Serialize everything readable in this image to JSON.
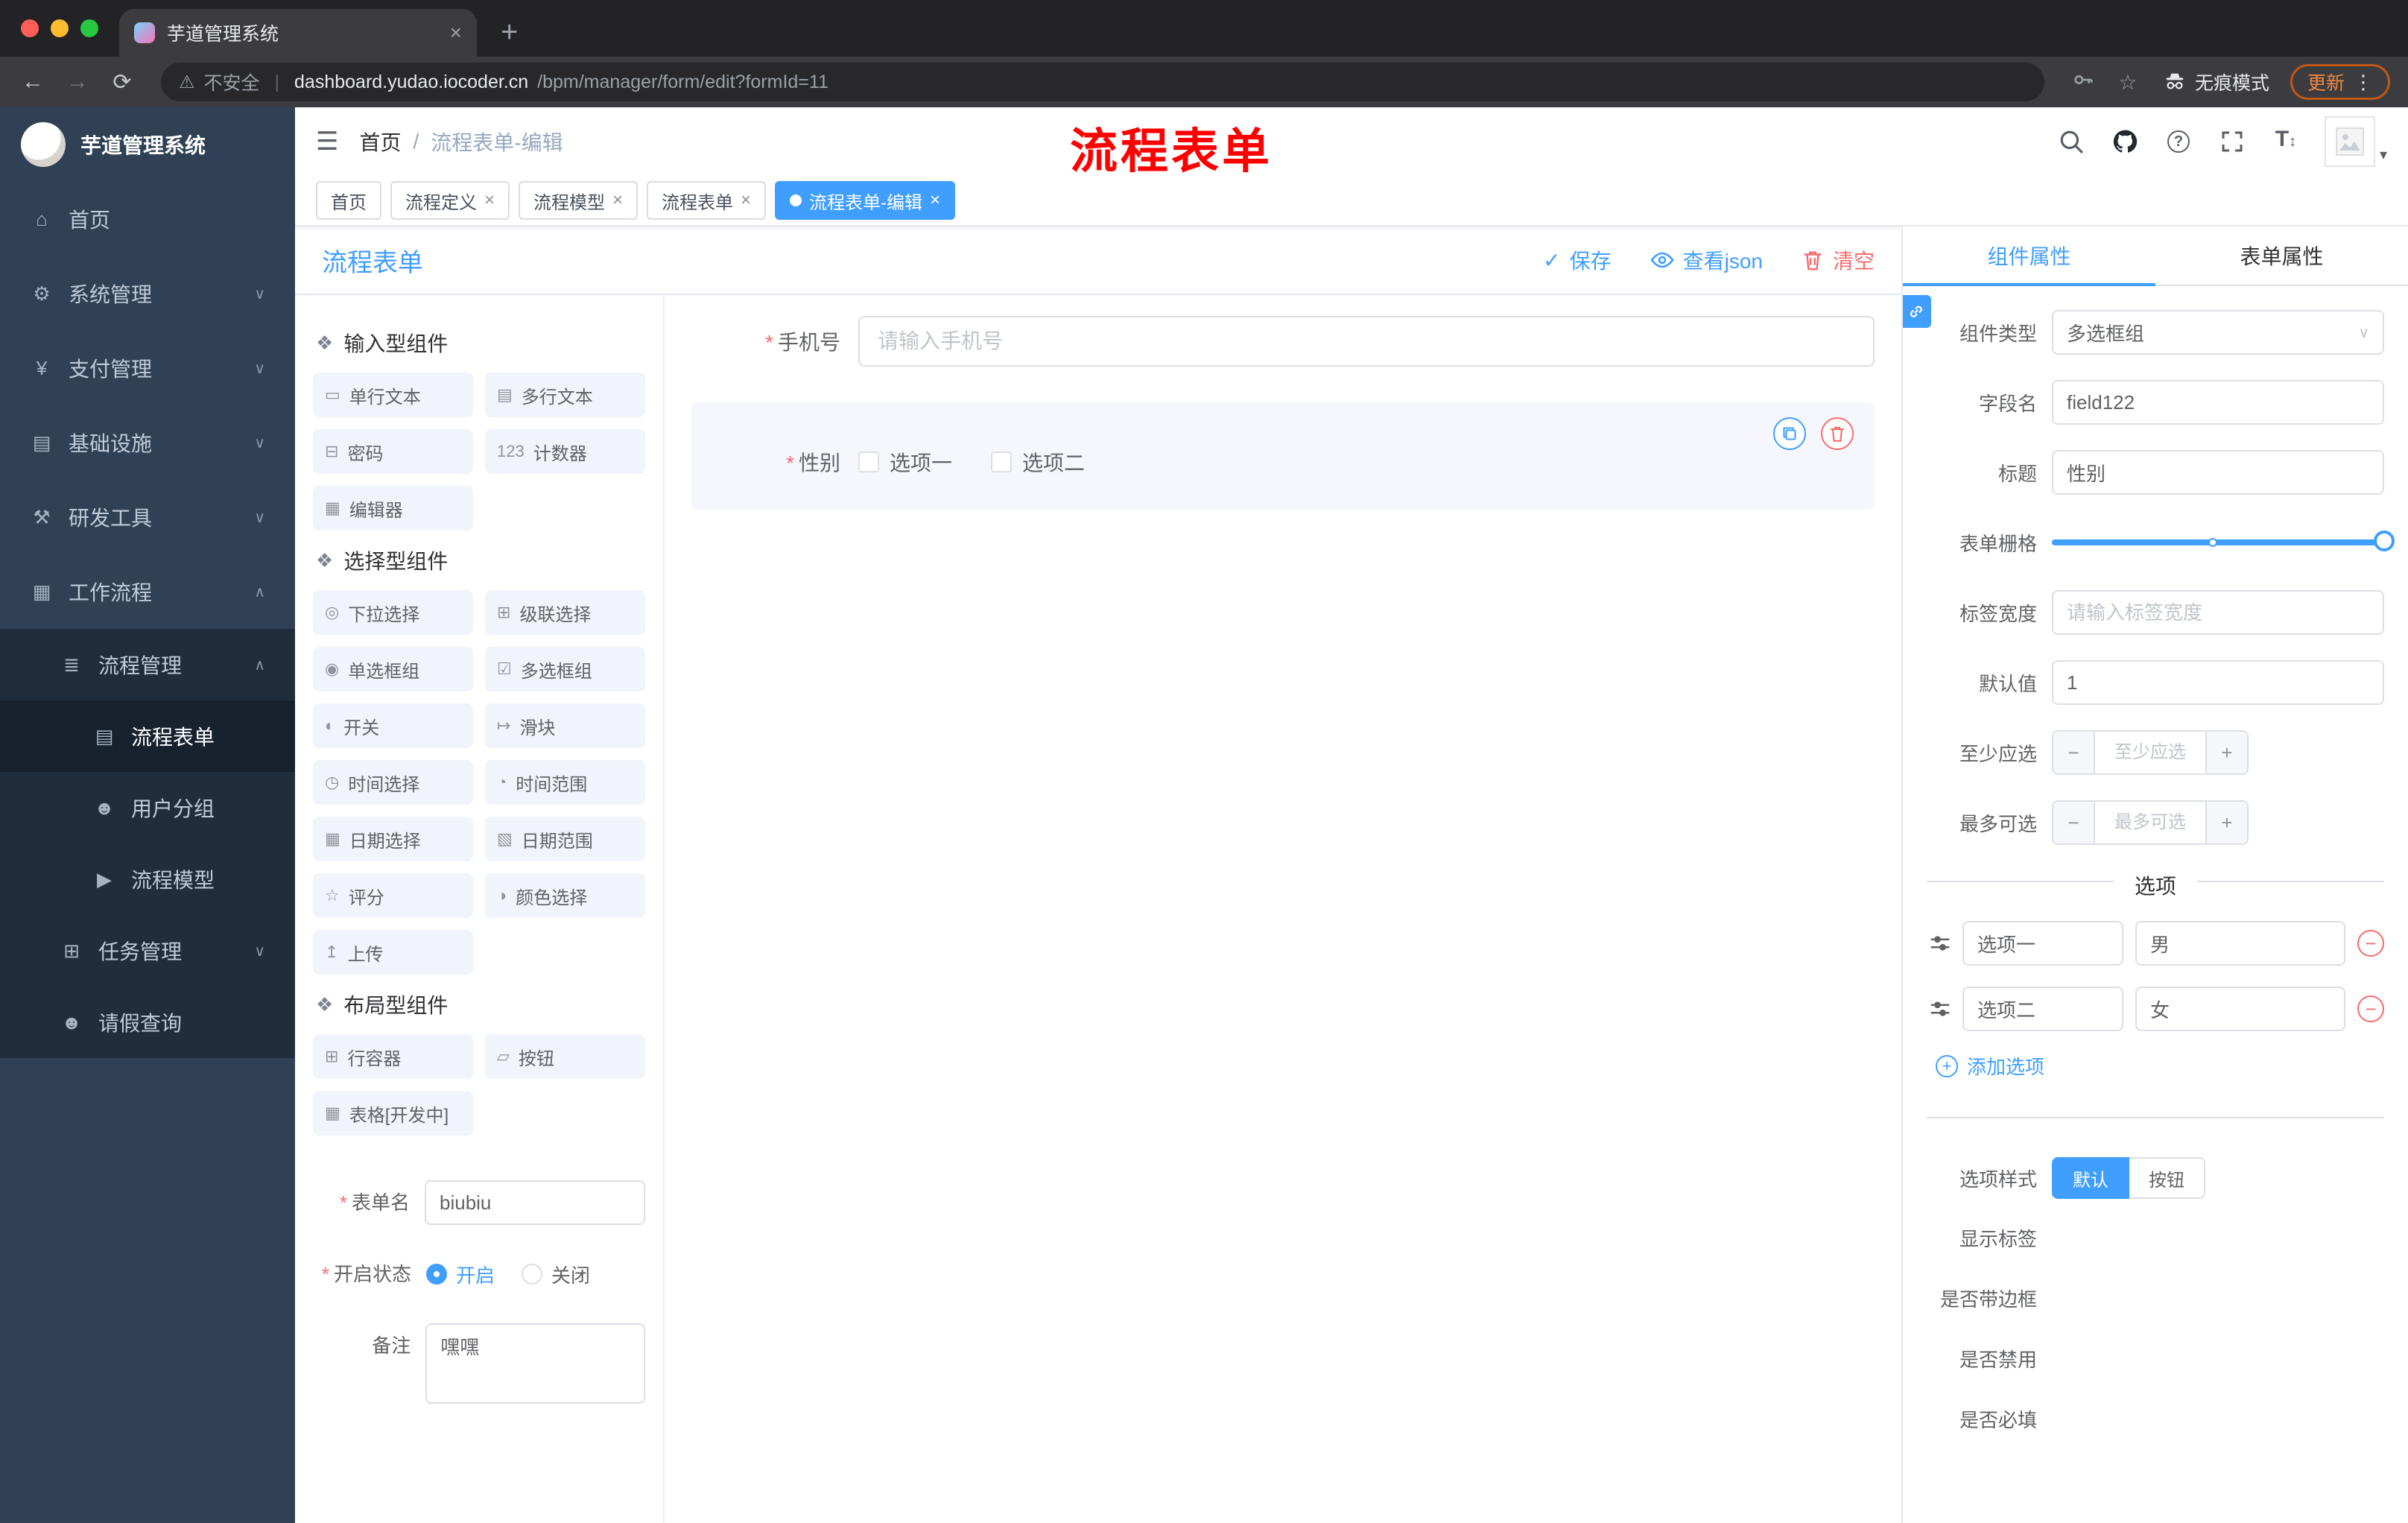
{
  "icons": {
    "hamburger": "☰",
    "chevron_down": "∨",
    "chevron_up": "∧",
    "close": "×",
    "plus": "+",
    "minus": "−",
    "check": "✓",
    "question": "?",
    "caret_down": "▾",
    "back": "←",
    "forward": "→",
    "reload": "⟳",
    "warning": "⚠",
    "ellipsis_v": "⋮",
    "font_large": "T",
    "font_resize": "↕",
    "home": "⌂",
    "gear": "⚙",
    "yen": "¥",
    "infra": "▤",
    "tools": "⚒",
    "workflow": "▦",
    "list": "≣",
    "doc": "▤",
    "users": "☻",
    "send": "▶",
    "tasks": "⊞",
    "person": "☻",
    "group": "❖",
    "p_single": "▭",
    "p_multi": "▤",
    "p_pwd": "⊟",
    "p_counter": "123",
    "p_editor": "▦",
    "p_select": "◎",
    "p_cascade": "⊞",
    "p_radio": "◉",
    "p_checkbox": "☑",
    "p_switch": "◐",
    "p_slider": "↦",
    "p_time": "◷",
    "p_timerange": "◔",
    "p_date": "▦",
    "p_daterange": "▧",
    "p_rate": "☆",
    "p_color": "◑",
    "p_upload": "↥",
    "p_row": "⊞",
    "p_button": "▱",
    "p_table": "▦"
  },
  "colors": {
    "accent": "#409eff",
    "danger": "#f56c6c"
  },
  "browser": {
    "tab_title": "芋道管理系统",
    "security_label": "不安全",
    "url_domain": "dashboard.yudao.iocoder.cn",
    "url_path": "/bpm/manager/form/edit?formId=11",
    "incognito_label": "无痕模式",
    "update_label": "更新"
  },
  "sidebar": {
    "logo_title": "芋道管理系统",
    "menu": [
      "首页",
      "系统管理",
      "支付管理",
      "基础设施",
      "研发工具",
      "工作流程",
      "流程管理",
      "流程表单",
      "用户分组",
      "流程模型",
      "任务管理",
      "请假查询"
    ]
  },
  "header": {
    "breadcrumb_home": "首页",
    "breadcrumb_sep": "/",
    "breadcrumb_current": "流程表单-编辑",
    "overlay_title": "流程表单"
  },
  "tags": [
    {
      "label": "首页"
    },
    {
      "label": "流程定义"
    },
    {
      "label": "流程模型"
    },
    {
      "label": "流程表单"
    },
    {
      "label": "流程表单-编辑"
    }
  ],
  "designer": {
    "title": "流程表单",
    "actions": {
      "save": "保存",
      "view_json": "查看json",
      "clear": "清空"
    },
    "groups": [
      {
        "title": "输入型组件",
        "items": [
          "单行文本",
          "多行文本",
          "密码",
          "计数器",
          "编辑器"
        ]
      },
      {
        "title": "选择型组件",
        "items": [
          "下拉选择",
          "级联选择",
          "单选框组",
          "多选框组",
          "开关",
          "滑块",
          "时间选择",
          "时间范围",
          "日期选择",
          "日期范围",
          "评分",
          "颜色选择",
          "上传"
        ]
      },
      {
        "title": "布局型组件",
        "items": [
          "行容器",
          "按钮",
          "表格[开发中]"
        ]
      }
    ],
    "meta": {
      "name_label": "表单名",
      "name_value": "biubiu",
      "status_label": "开启状态",
      "status_on": "开启",
      "status_off": "关闭",
      "remark_label": "备注",
      "remark_value": "嘿嘿"
    },
    "canvas": {
      "phone_label": "手机号",
      "phone_placeholder": "请输入手机号",
      "gender_label": "性别",
      "gender_option1": "选项一",
      "gender_option2": "选项二"
    }
  },
  "props": {
    "tab_component": "组件属性",
    "tab_form": "表单属性",
    "fields": {
      "component_type_label": "组件类型",
      "component_type_value": "多选框组",
      "field_name_label": "字段名",
      "field_name_value": "field122",
      "title_label": "标题",
      "title_value": "性别",
      "grid_label": "表单栅格",
      "label_width_label": "标签宽度",
      "label_width_placeholder": "请输入标签宽度",
      "default_label": "默认值",
      "default_value": "1",
      "min_label": "至少应选",
      "min_placeholder": "至少应选",
      "max_label": "最多可选",
      "max_placeholder": "最多可选"
    },
    "options": {
      "divider_title": "选项",
      "rows": [
        {
          "label": "选项一",
          "value": "男"
        },
        {
          "label": "选项二",
          "value": "女"
        }
      ],
      "add_label": "添加选项"
    },
    "style": {
      "option_style_label": "选项样式",
      "style_default": "默认",
      "style_button": "按钮",
      "toggle_show_label": "显示标签",
      "toggle_border": "是否带边框",
      "toggle_disabled": "是否禁用",
      "toggle_required": "是否必填"
    }
  }
}
